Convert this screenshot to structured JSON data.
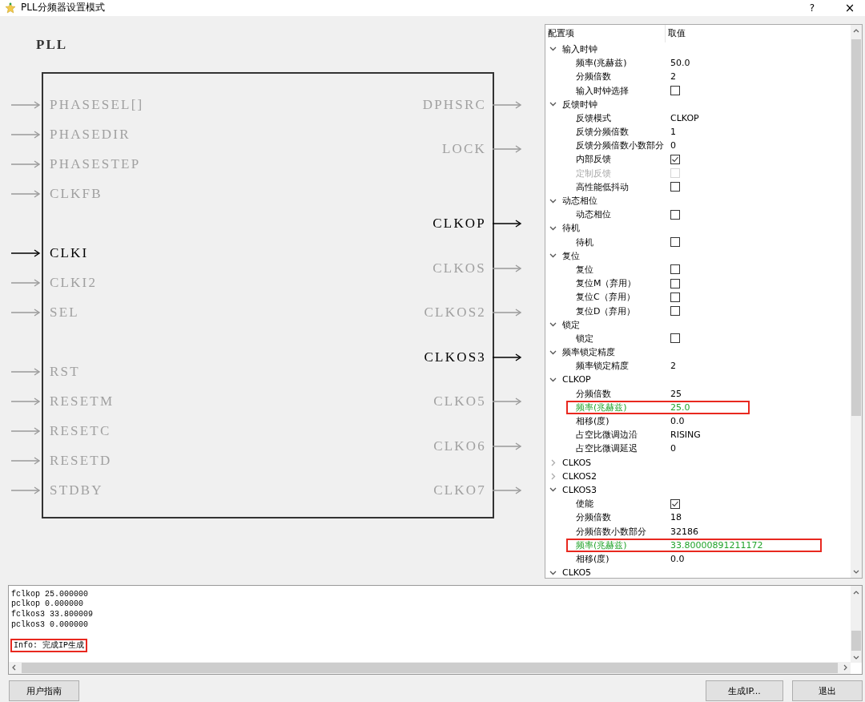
{
  "window": {
    "title": "PLL分频器设置模式",
    "help": "?",
    "close": "×"
  },
  "diagram": {
    "title": "PLL",
    "inputs": [
      {
        "label": "PHASESEL[]",
        "active": false
      },
      {
        "label": "PHASEDIR",
        "active": false
      },
      {
        "label": "PHASESTEP",
        "active": false
      },
      {
        "label": "CLKFB",
        "active": false
      },
      {
        "label": "CLKI",
        "active": true
      },
      {
        "label": "CLKI2",
        "active": false
      },
      {
        "label": "SEL",
        "active": false
      },
      {
        "label": "RST",
        "active": false
      },
      {
        "label": "RESETM",
        "active": false
      },
      {
        "label": "RESETC",
        "active": false
      },
      {
        "label": "RESETD",
        "active": false
      },
      {
        "label": "STDBY",
        "active": false
      }
    ],
    "outputs": [
      {
        "label": "DPHSRC",
        "active": false
      },
      {
        "label": "LOCK",
        "active": false
      },
      {
        "label": "CLKOP",
        "active": true
      },
      {
        "label": "CLKOS",
        "active": false
      },
      {
        "label": "CLKOS2",
        "active": false
      },
      {
        "label": "CLKOS3",
        "active": true
      },
      {
        "label": "CLKO5",
        "active": false
      },
      {
        "label": "CLKO6",
        "active": false
      },
      {
        "label": "CLKO7",
        "active": false
      }
    ]
  },
  "tree": {
    "columns": [
      "配置项",
      "取值"
    ],
    "items": [
      {
        "label": "输入时钟",
        "expanded": true,
        "children": [
          {
            "label": "频率(兆赫兹)",
            "kind": "text",
            "value": "50.0",
            "highlighted": false
          },
          {
            "label": "分频倍数",
            "kind": "text",
            "value": "2",
            "highlighted": false
          },
          {
            "label": "输入时钟选择",
            "kind": "checkbox",
            "checked": false,
            "disabled": false,
            "highlighted": false
          }
        ]
      },
      {
        "label": "反馈时钟",
        "expanded": true,
        "children": [
          {
            "label": "反馈模式",
            "kind": "text",
            "value": "CLKOP",
            "highlighted": false
          },
          {
            "label": "反馈分频倍数",
            "kind": "text",
            "value": "1",
            "highlighted": false
          },
          {
            "label": "反馈分频倍数小数部分",
            "kind": "text",
            "value": "0",
            "highlighted": false
          },
          {
            "label": "内部反馈",
            "kind": "checkbox",
            "checked": true,
            "disabled": false,
            "highlighted": false
          },
          {
            "label": "定制反馈",
            "kind": "checkbox",
            "checked": false,
            "disabled": true,
            "highlighted": false
          },
          {
            "label": "高性能低抖动",
            "kind": "checkbox",
            "checked": false,
            "disabled": false,
            "highlighted": false
          }
        ]
      },
      {
        "label": "动态相位",
        "expanded": true,
        "children": [
          {
            "label": "动态相位",
            "kind": "checkbox",
            "checked": false,
            "disabled": false,
            "highlighted": false
          }
        ]
      },
      {
        "label": "待机",
        "expanded": true,
        "children": [
          {
            "label": "待机",
            "kind": "checkbox",
            "checked": false,
            "disabled": false,
            "highlighted": false
          }
        ]
      },
      {
        "label": "复位",
        "expanded": true,
        "children": [
          {
            "label": "复位",
            "kind": "checkbox",
            "checked": false,
            "disabled": false,
            "highlighted": false
          },
          {
            "label": "复位M（弃用）",
            "kind": "checkbox",
            "checked": false,
            "disabled": false,
            "highlighted": false
          },
          {
            "label": "复位C（弃用）",
            "kind": "checkbox",
            "checked": false,
            "disabled": false,
            "highlighted": false
          },
          {
            "label": "复位D（弃用）",
            "kind": "checkbox",
            "checked": false,
            "disabled": false,
            "highlighted": false
          }
        ]
      },
      {
        "label": "锁定",
        "expanded": true,
        "children": [
          {
            "label": "锁定",
            "kind": "checkbox",
            "checked": false,
            "disabled": false,
            "highlighted": false
          }
        ]
      },
      {
        "label": "频率锁定精度",
        "expanded": true,
        "children": [
          {
            "label": "频率锁定精度",
            "kind": "text",
            "value": "2",
            "highlighted": false
          }
        ]
      },
      {
        "label": "CLKOP",
        "expanded": true,
        "children": [
          {
            "label": "分频倍数",
            "kind": "text",
            "value": "25",
            "highlighted": false
          },
          {
            "label": "频率(兆赫兹)",
            "kind": "text",
            "value": "25.0",
            "highlighted": true
          },
          {
            "label": "相移(度)",
            "kind": "text",
            "value": "0.0",
            "highlighted": false
          },
          {
            "label": "占空比微调边沿",
            "kind": "text",
            "value": "RISING",
            "highlighted": false
          },
          {
            "label": "占空比微调延迟",
            "kind": "text",
            "value": "0",
            "highlighted": false
          }
        ]
      },
      {
        "label": "CLKOS",
        "expanded": false
      },
      {
        "label": "CLKOS2",
        "expanded": false
      },
      {
        "label": "CLKOS3",
        "expanded": true,
        "children": [
          {
            "label": "使能",
            "kind": "checkbox",
            "checked": true,
            "disabled": false,
            "highlighted": false
          },
          {
            "label": "分频倍数",
            "kind": "text",
            "value": "18",
            "highlighted": false
          },
          {
            "label": "分频倍数小数部分",
            "kind": "text",
            "value": "32186",
            "highlighted": false
          },
          {
            "label": "频率(兆赫兹)",
            "kind": "text",
            "value": "33.80000891211172",
            "highlighted": true
          },
          {
            "label": "相移(度)",
            "kind": "text",
            "value": "0.0",
            "highlighted": false
          }
        ]
      },
      {
        "label": "CLKO5",
        "expanded": true
      }
    ]
  },
  "log": {
    "lines": [
      {
        "text": "fclkop 25.000000",
        "highlighted": false
      },
      {
        "text": "pclkop 0.000000",
        "highlighted": false
      },
      {
        "text": "fclkos3 33.800009",
        "highlighted": false
      },
      {
        "text": "pclkos3 0.000000",
        "highlighted": false
      },
      {
        "text": "Info: 完成IP生成",
        "highlighted": true
      }
    ]
  },
  "buttons": {
    "left": [
      "用户指南"
    ],
    "right": [
      "生成IP...",
      "退出"
    ]
  }
}
